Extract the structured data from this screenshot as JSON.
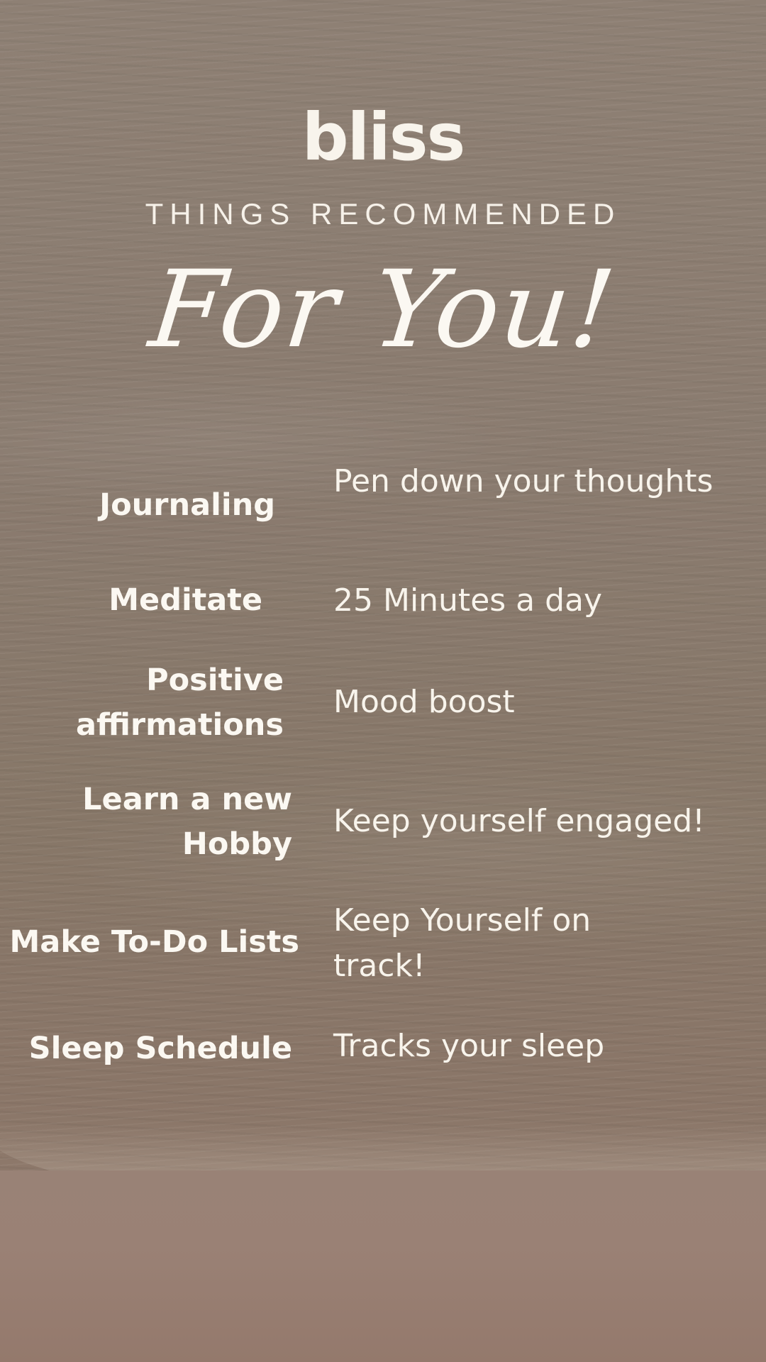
{
  "brand": {
    "logo": "bliss"
  },
  "header": {
    "subtitle": "THINGS RECOMMENDED",
    "headline": "For You!"
  },
  "items": [
    {
      "label": "Journaling",
      "description": "Pen down your thoughts"
    },
    {
      "label": "Meditate",
      "description": "25 Minutes a day"
    },
    {
      "label": "Positive affirmations",
      "description": "Mood boost"
    },
    {
      "label": "Learn a new Hobby",
      "description": "Keep yourself engaged!"
    },
    {
      "label": "Make To-Do Lists",
      "description": "Keep Yourself on track!"
    },
    {
      "label": "Sleep Schedule",
      "description": "Tracks your sleep"
    }
  ],
  "colors": {
    "text": "#f8f4ec",
    "background": "#8a7b6f"
  }
}
